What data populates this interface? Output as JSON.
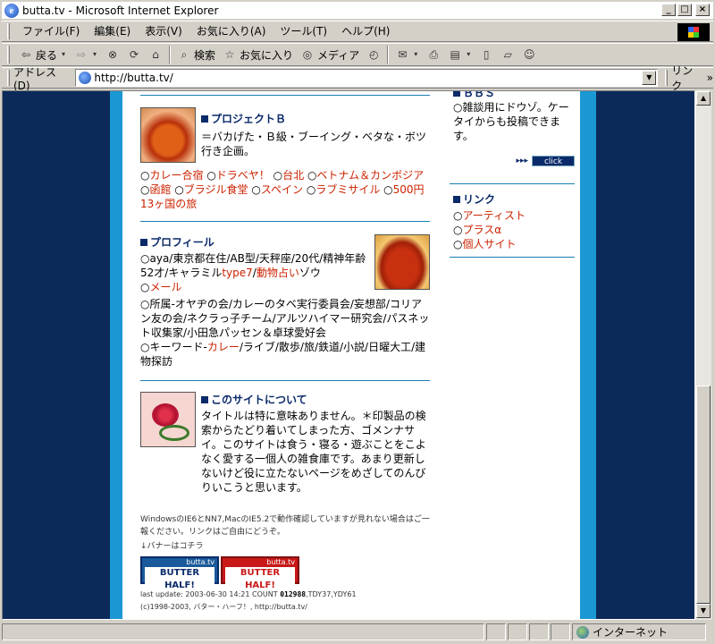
{
  "window": {
    "title": "butta.tv - Microsoft Internet Explorer",
    "buttons": [
      "_",
      "□",
      "×"
    ]
  },
  "menu": [
    "ファイル(F)",
    "編集(E)",
    "表示(V)",
    "お気に入り(A)",
    "ツール(T)",
    "ヘルプ(H)"
  ],
  "toolbar": {
    "back": "戻る",
    "search": "検索",
    "favorites": "お気に入り",
    "media": "メディア"
  },
  "address": {
    "label": "アドレス(D)",
    "url": "http://butta.tv/",
    "links": "リンク"
  },
  "status": {
    "zone": "インターネット"
  },
  "page": {
    "project": {
      "heading": "プロジェクトＢ",
      "desc": "＝バカげた・Ｂ級・ブーイング・ベタな・ボツ行き企画。",
      "links": [
        "カレー合宿",
        "ドラベヤ！",
        "台北",
        "ベトナム＆カンボジア",
        "函館",
        "ブラジル食堂",
        "スペイン",
        "ラブミサイル",
        "500円13ヶ国の旅"
      ]
    },
    "profile": {
      "heading": "プロフィール",
      "line1_a": "aya/東京都在住/AB型/天秤座/20代/精神年齢52才/キャラミル",
      "line1_link1": "type7",
      "line1_sep": "/",
      "line1_link2": "動物占い",
      "line1_b": "ゾウ",
      "mail": "メール",
      "affil": "所属-オヤヂの会/カレーのタベ実行委員会/妄想部/コリアン友の会/ネクラっ子チーム/アルツハイマー研究会/パスネット収集家/小田急パッセン＆卓球愛好会",
      "kw_a": "キーワード-",
      "kw_link": "カレー",
      "kw_b": "/ライブ/散歩/旅/鉄道/小説/日曜大工/建物探訪"
    },
    "about": {
      "heading": "このサイトについて",
      "text": "タイトルは特に意味ありません。＊印製品の検索からたどり着いてしまった方、ゴメンナサイ。このサイトは食う・寝る・遊ぶことをこよなく愛する一個人の雑食庫です。あまり更新しないけど役に立たないページをめざしてのんびりいこうと思います。"
    },
    "footer": {
      "note1": "WindowsのIE6とNN7,MacのIE5.2で動作確認していますが見れない場合はご一報ください。リンクはご自由にどうぞ。",
      "note2": "↓バナーはコチラ",
      "banner_top": "butta.tv",
      "banner_main": "BUTTER HALF!",
      "update_a": "last update: 2003-06-30 14:21 COUNT ",
      "count": "012988",
      "update_b": ",TDY37,YDY61",
      "copyright": "(c)1998-2003, バター・ハーフ！, http://butta.tv/"
    },
    "bbs": {
      "heading": "ＢＢＳ",
      "text": "雑談用にドウゾ。ケータイからも投稿できます。",
      "click": "click",
      "arrows": "▸▸▸"
    },
    "links": {
      "heading": "リンク",
      "items": [
        "アーティスト",
        "プラスα",
        "個人サイト"
      ]
    }
  }
}
